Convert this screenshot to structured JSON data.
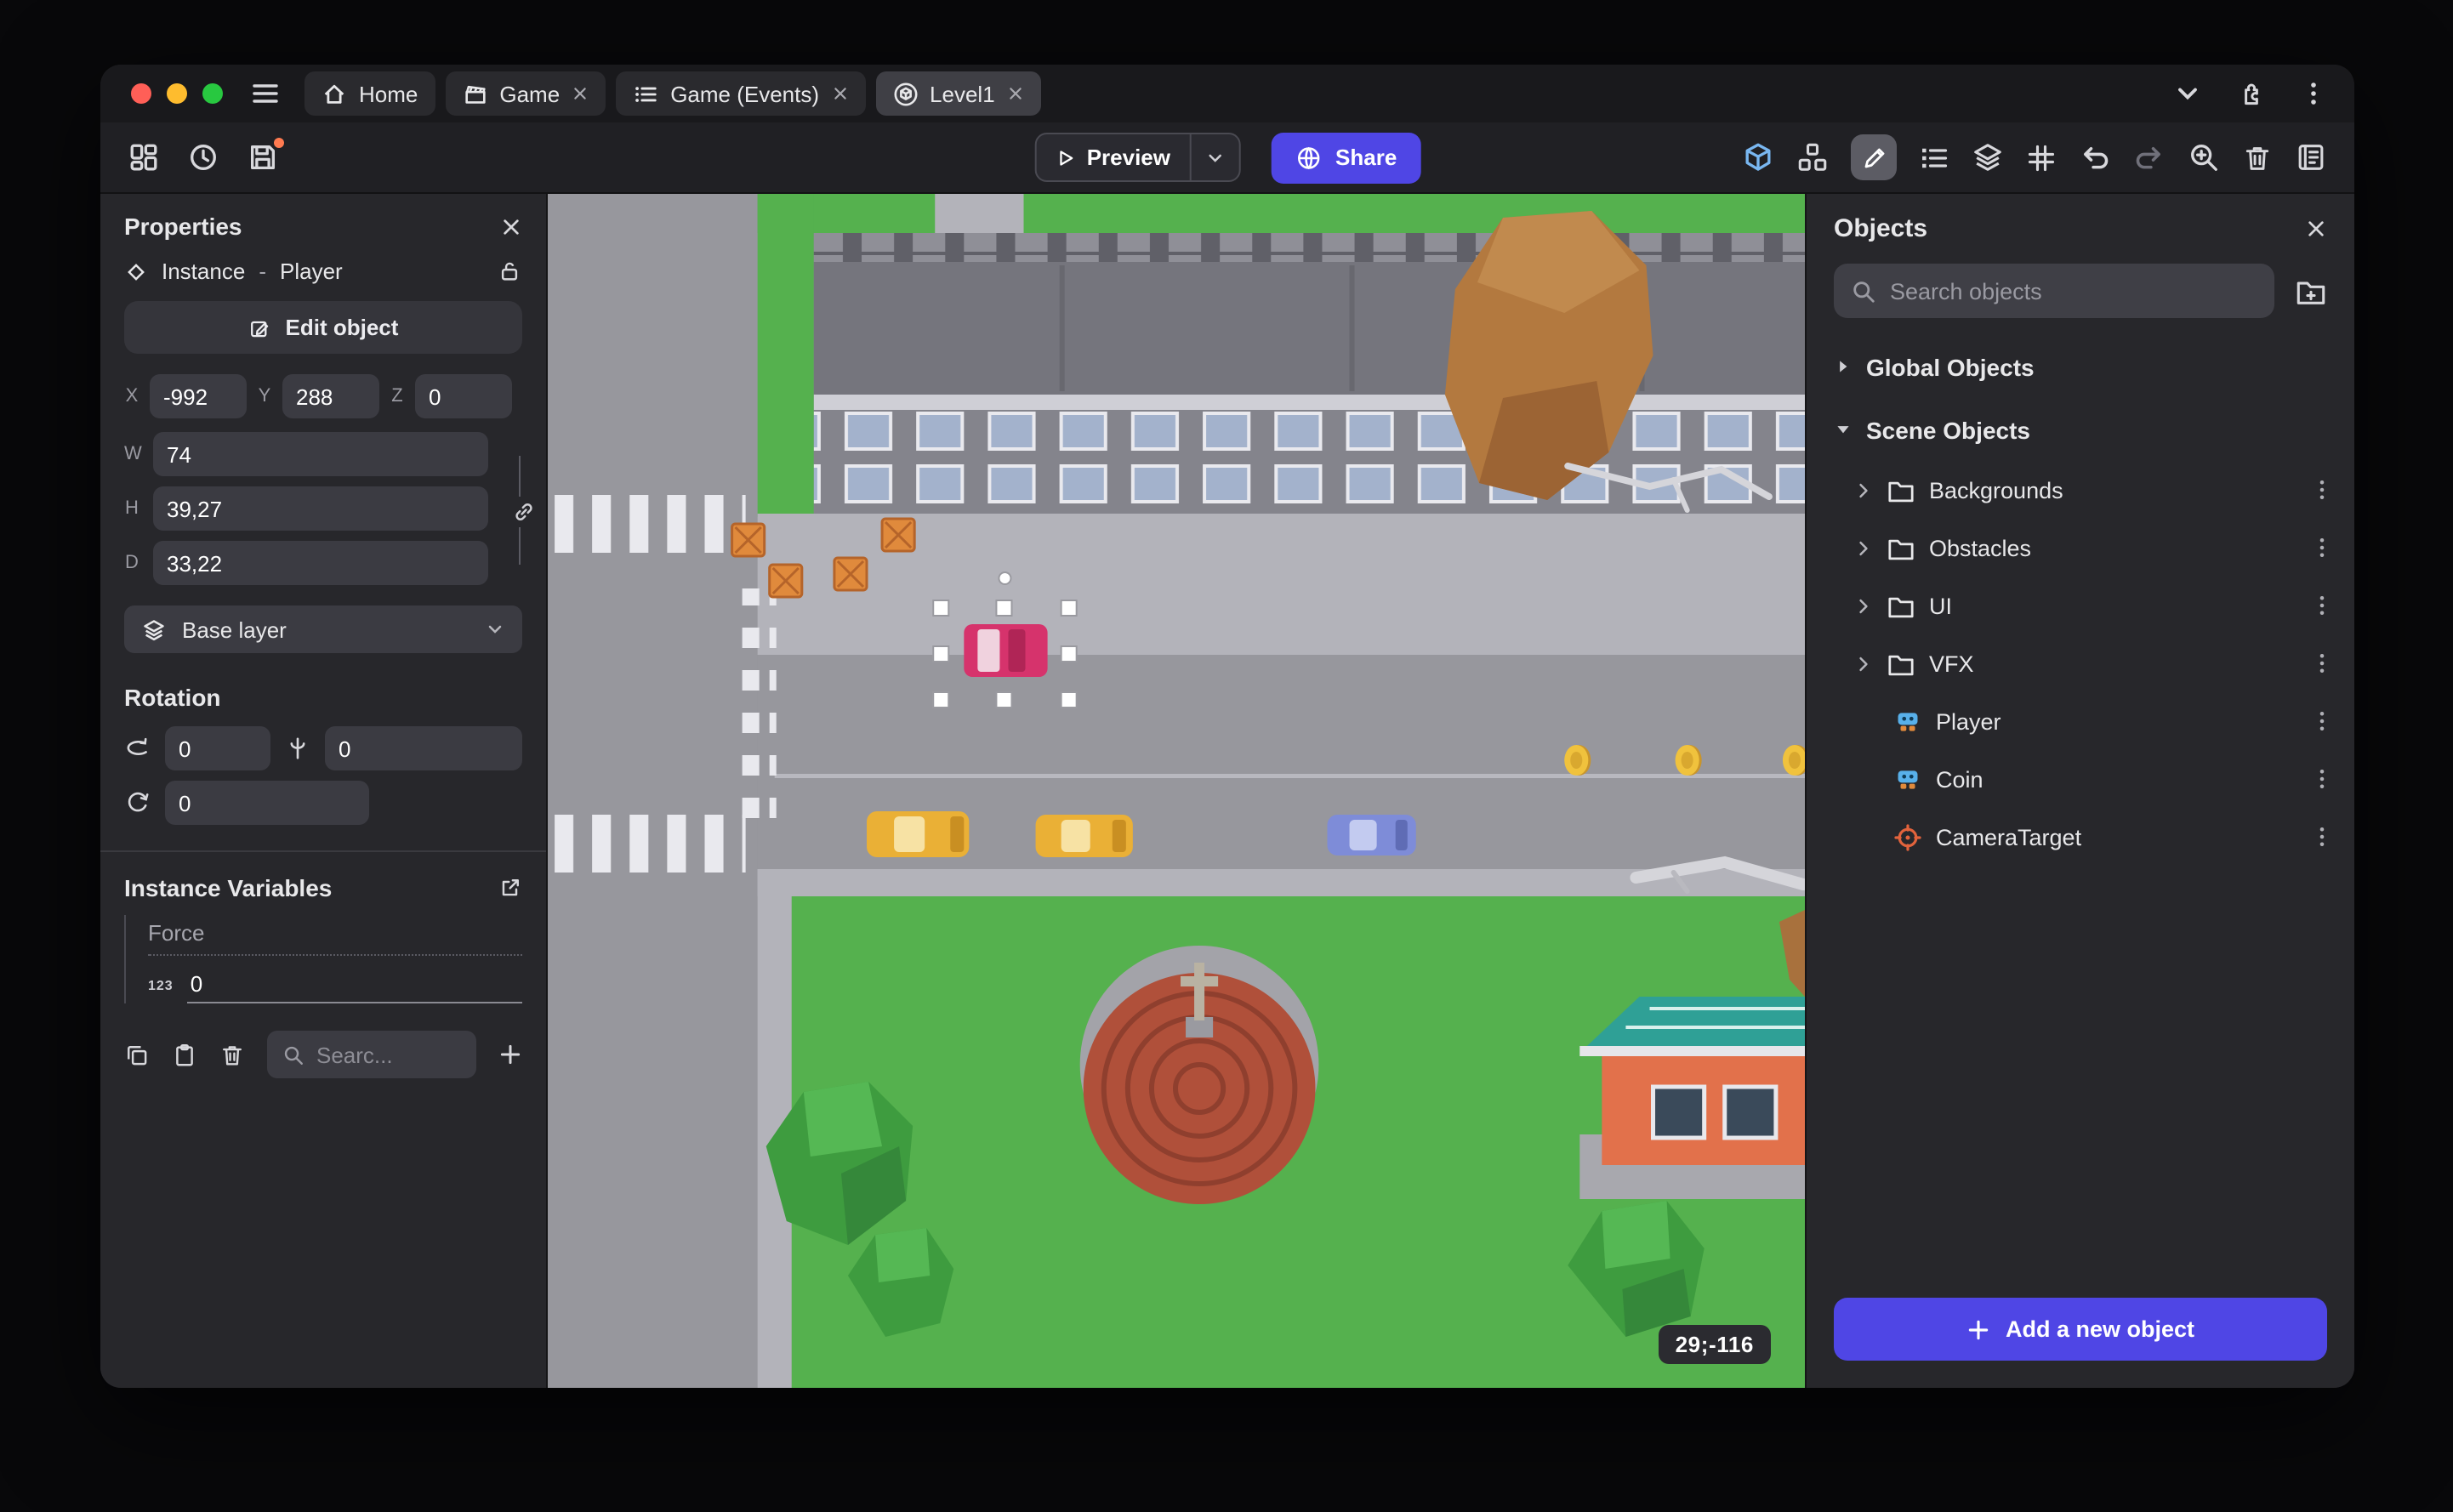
{
  "window": {
    "tabs": [
      {
        "label": "Home"
      },
      {
        "label": "Game"
      },
      {
        "label": "Game (Events)"
      },
      {
        "label": "Level1"
      }
    ]
  },
  "toolbar": {
    "preview_label": "Preview",
    "share_label": "Share"
  },
  "properties": {
    "title": "Properties",
    "instance_label": "Instance",
    "separator": "-",
    "instance_name": "Player",
    "edit_object_label": "Edit object",
    "position": {
      "x_label": "X",
      "x": "-992",
      "y_label": "Y",
      "y": "288",
      "z_label": "Z",
      "z": "0"
    },
    "size": {
      "w_label": "W",
      "w": "74",
      "h_label": "H",
      "h": "39,27",
      "d_label": "D",
      "d": "33,22"
    },
    "layer": "Base layer",
    "rotation_title": "Rotation",
    "rotation": {
      "x": "0",
      "y": "0",
      "z": "0"
    },
    "variables_title": "Instance Variables",
    "variables": [
      {
        "name": "Force",
        "type": "123",
        "value": "0"
      }
    ],
    "search_placeholder": "Searc..."
  },
  "scene": {
    "coordinates": "29;-116"
  },
  "objects_panel": {
    "title": "Objects",
    "search_placeholder": "Search objects",
    "groups": [
      {
        "label": "Global Objects"
      },
      {
        "label": "Scene Objects"
      }
    ],
    "folders": [
      "Backgrounds",
      "Obstacles",
      "UI",
      "VFX"
    ],
    "items": [
      {
        "label": "Player",
        "icon": "sprite-icon"
      },
      {
        "label": "Coin",
        "icon": "sprite-icon"
      },
      {
        "label": "CameraTarget",
        "icon": "camera-target-icon"
      }
    ],
    "add_button_label": "Add a new object"
  },
  "colors": {
    "accent": "#4f46e5",
    "traffic_red": "#ff5f57",
    "traffic_yellow": "#febc2e",
    "traffic_green": "#28c840",
    "save_notification_dot": "#ff7a50",
    "selection_handle": "#ffffff",
    "grass": "#55b14e",
    "road": "#97979d"
  },
  "icons": {
    "hamburger-menu": "≡",
    "close": "×",
    "search": "⌕",
    "chevron-down": "⌄",
    "chevron-right": "›",
    "kebab-menu": "⋮",
    "plus": "+",
    "triangle-collapsed": "▸",
    "triangle-expanded": "▾"
  }
}
